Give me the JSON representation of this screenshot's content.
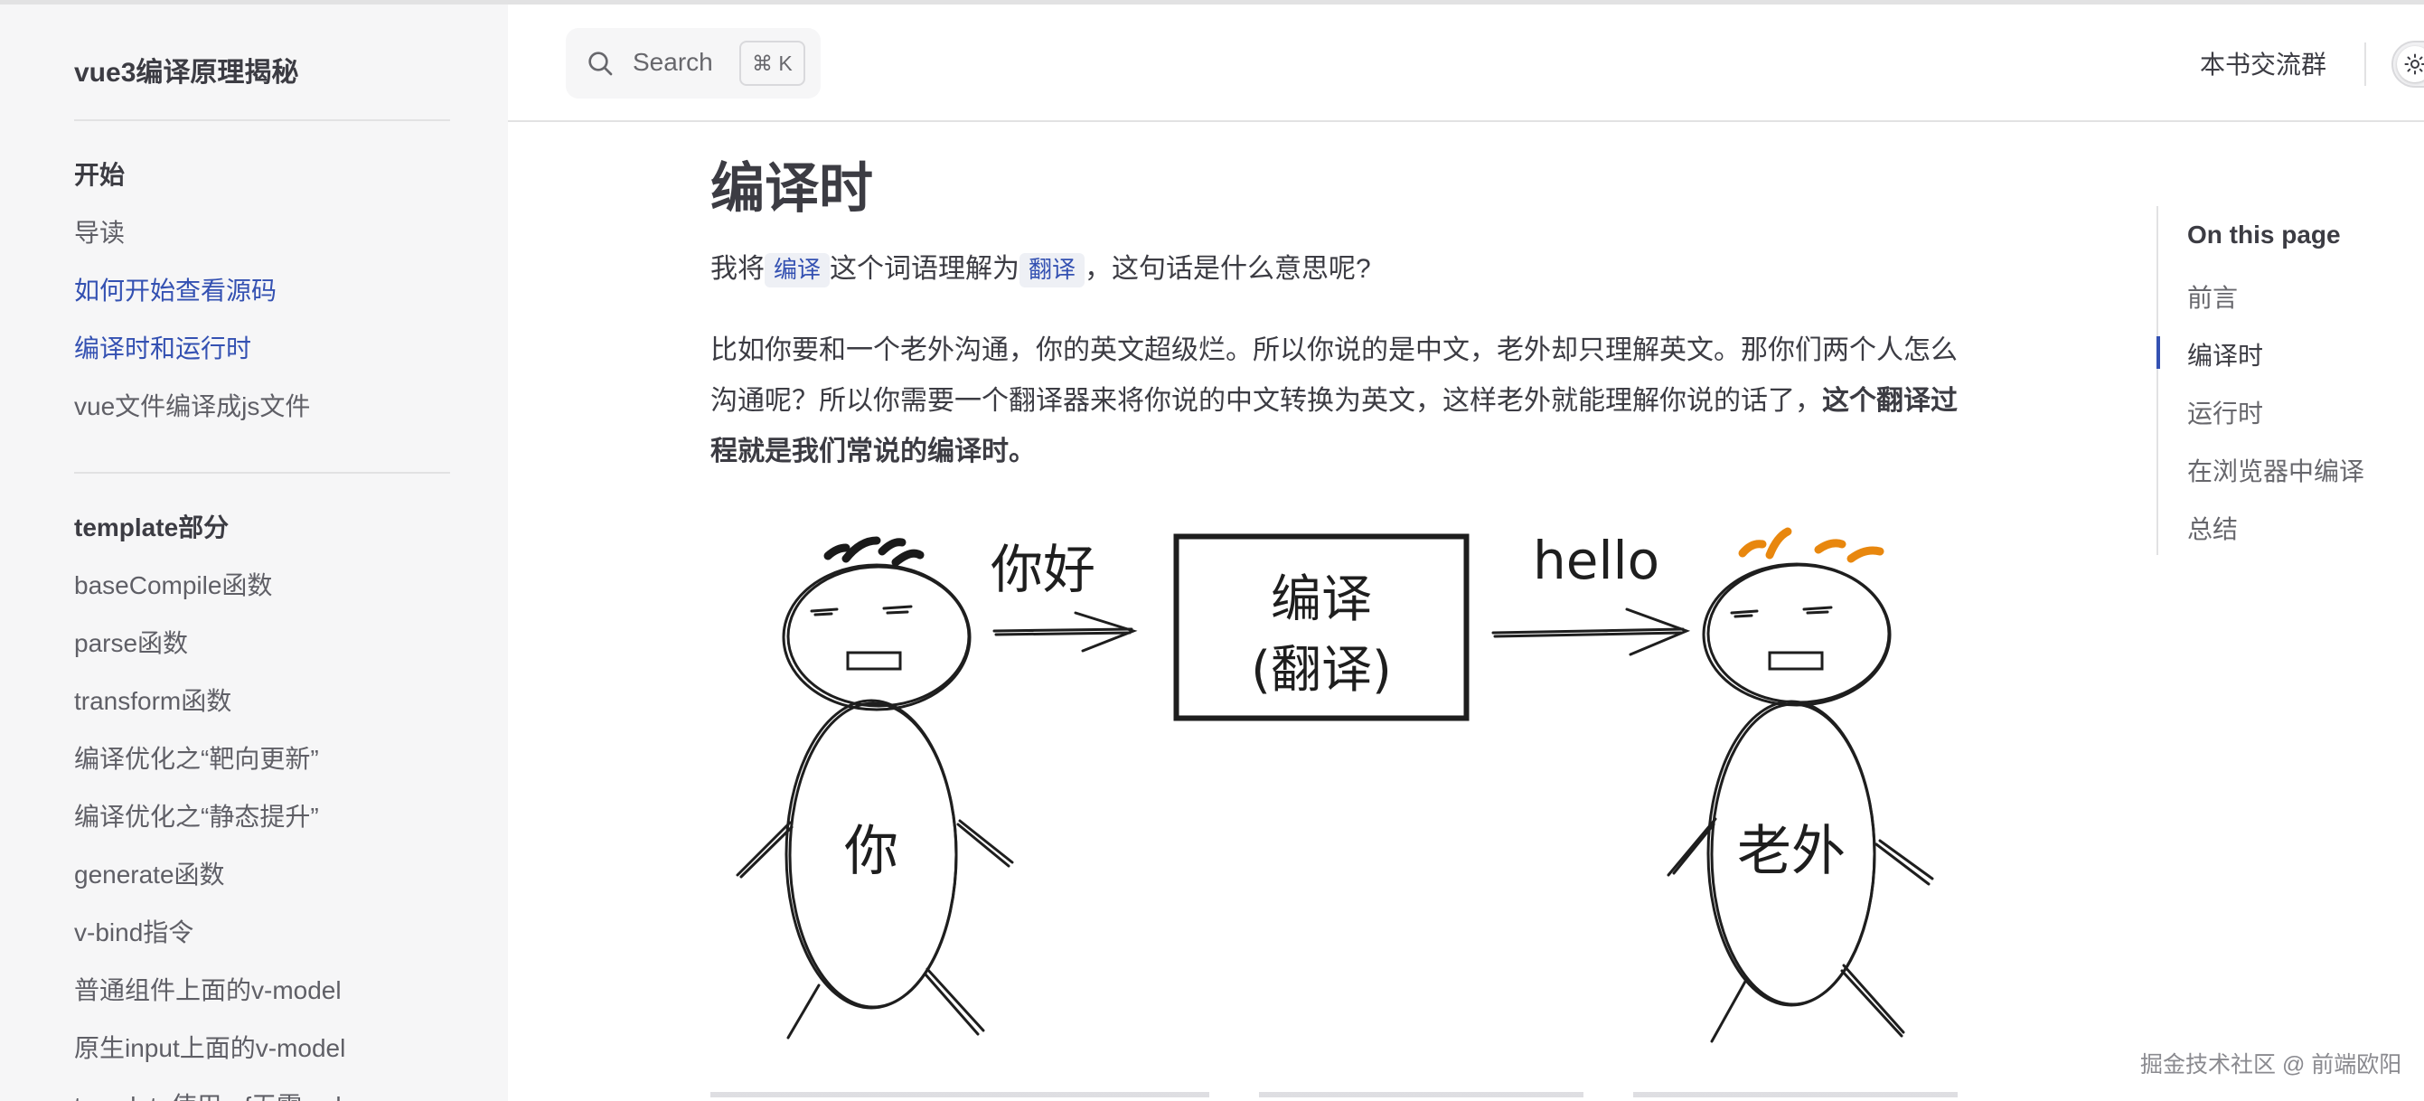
{
  "site": {
    "title": "vue3编译原理揭秘"
  },
  "header": {
    "search_label": "Search",
    "search_shortcut": "⌘ K",
    "nav_link": "本书交流群",
    "theme_icon": "sun-icon"
  },
  "sidebar": {
    "groups": [
      {
        "title": "开始",
        "items": [
          {
            "label": "导读",
            "active": false
          },
          {
            "label": "如何开始查看源码",
            "active": true
          },
          {
            "label": "编译时和运行时",
            "active": true
          },
          {
            "label": "vue文件编译成js文件",
            "active": false
          }
        ]
      },
      {
        "title": "template部分",
        "items": [
          {
            "label": "baseCompile函数"
          },
          {
            "label": "parse函数"
          },
          {
            "label": "transform函数"
          },
          {
            "label": "编译优化之“靶向更新”"
          },
          {
            "label": "编译优化之“静态提升”"
          },
          {
            "label": "generate函数"
          },
          {
            "label": "v-bind指令"
          },
          {
            "label": "普通组件上面的v-model"
          },
          {
            "label": "原生input上面的v-model"
          },
          {
            "label": "template使用ref无需.value"
          }
        ]
      }
    ]
  },
  "content": {
    "title": "编译时",
    "p1": {
      "before": "我将",
      "code1": "编译",
      "middle": "这个词语理解为",
      "code2": "翻译",
      "after": "，这句话是什么意思呢?"
    },
    "p2": {
      "text": "比如你要和一个老外沟通，你的英文超级烂。所以你说的是中文，老外却只理解英文。那你们两个人怎么沟通呢？所以你需要一个翻译器来将你说的中文转换为英文，这样老外就能理解你说的话了，",
      "bold": "这个翻译过程就是我们常说的编译时。"
    },
    "illustration": {
      "left_person": "你",
      "right_person": "老外",
      "left_speech": "你好",
      "right_speech": "hello",
      "box_line1": "编译",
      "box_line2": "(翻译)",
      "hair_left_color": "#1a1a1a",
      "hair_right_color": "#e8870e"
    }
  },
  "outline": {
    "title": "On this page",
    "items": [
      {
        "label": "前言",
        "active": false
      },
      {
        "label": "编译时",
        "active": true
      },
      {
        "label": "运行时",
        "active": false
      },
      {
        "label": "在浏览器中编译",
        "active": false
      },
      {
        "label": "总结",
        "active": false
      }
    ]
  },
  "watermark": "掘金技术社区 @ 前端欧阳",
  "colors": {
    "accent": "#3451b2",
    "sidebar_bg": "#f6f6f7",
    "text": "#3c3c43"
  }
}
